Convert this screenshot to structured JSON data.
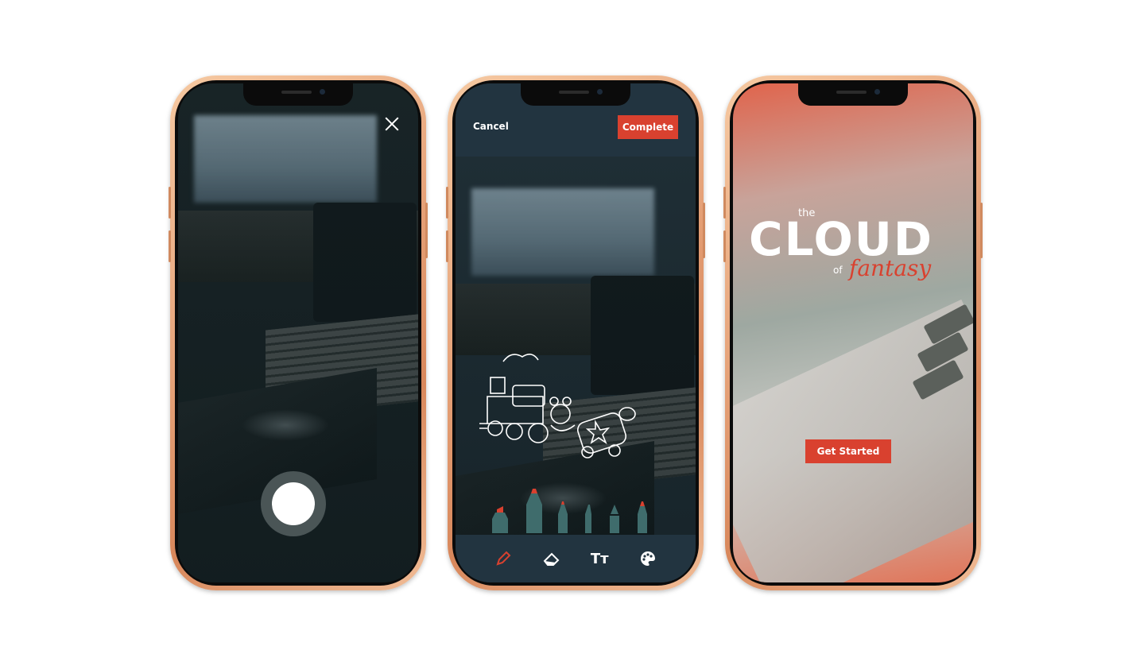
{
  "camera_screen": {
    "close_icon": "close-icon",
    "shutter_icon": "shutter-button"
  },
  "editor_screen": {
    "cancel_label": "Cancel",
    "complete_label": "Complete",
    "drawing_icon": "toy-train-doodle",
    "markers": [
      "highlighter",
      "marker",
      "pen-wide",
      "pen-fine",
      "fountain-pen",
      "pencil"
    ],
    "toolbar": {
      "pencil_icon": "pencil-icon",
      "eraser_icon": "eraser-icon",
      "text_label": "Tт",
      "palette_icon": "palette-icon"
    }
  },
  "welcome_screen": {
    "logo_the": "the",
    "logo_cloud": "CLOUD",
    "logo_of": "of",
    "logo_fantasy": "fantasy",
    "get_started_label": "Get Started"
  },
  "colors": {
    "accent": "#d9412f",
    "bar_bg": "#223440",
    "marker_teal": "#3f6c6c"
  }
}
